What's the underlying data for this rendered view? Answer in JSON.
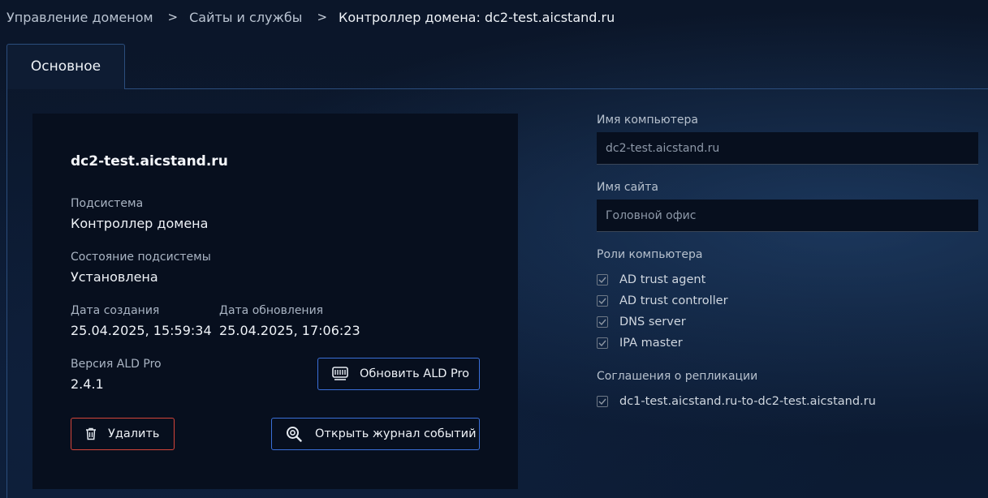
{
  "breadcrumb": {
    "items": [
      "Управление доменом",
      "Сайты и службы",
      "Контроллер домена: dc2-test.aicstand.ru"
    ],
    "separator": ">"
  },
  "tabs": [
    {
      "label": "Основное",
      "active": true
    }
  ],
  "card": {
    "title": "dc2-test.aicstand.ru",
    "subsystem_label": "Подсистема",
    "subsystem_value": "Контроллер домена",
    "state_label": "Состояние подсистемы",
    "state_value": "Установлена",
    "created_label": "Дата создания",
    "created_value": "25.04.2025, 15:59:34",
    "updated_label": "Дата обновления",
    "updated_value": "25.04.2025, 17:06:23",
    "version_label": "Версия ALD Pro",
    "version_value": "2.4.1",
    "update_button": "Обновить ALD Pro",
    "delete_button": "Удалить",
    "journal_button": "Открыть журнал событий"
  },
  "form": {
    "computer_name_label": "Имя компьютера",
    "computer_name_value": "dc2-test.aicstand.ru",
    "site_name_label": "Имя сайта",
    "site_name_value": "Головной офис",
    "roles_label": "Роли компьютера",
    "roles": [
      {
        "label": "AD trust agent",
        "checked": true
      },
      {
        "label": "AD trust controller",
        "checked": true
      },
      {
        "label": "DNS server",
        "checked": true
      },
      {
        "label": "IPA master",
        "checked": true
      }
    ],
    "replication_label": "Соглашения о репликации",
    "replications": [
      {
        "label": "dc1-test.aicstand.ru-to-dc2-test.aicstand.ru",
        "checked": true
      }
    ]
  },
  "colors": {
    "accent_blue": "#3a6fd8",
    "danger_red": "#d4453a",
    "card_bg": "#070f1e"
  },
  "icons": {
    "update_button": "server-update-icon",
    "delete_button": "trash-icon",
    "journal_button": "search-log-icon",
    "checkbox": "check-icon"
  }
}
